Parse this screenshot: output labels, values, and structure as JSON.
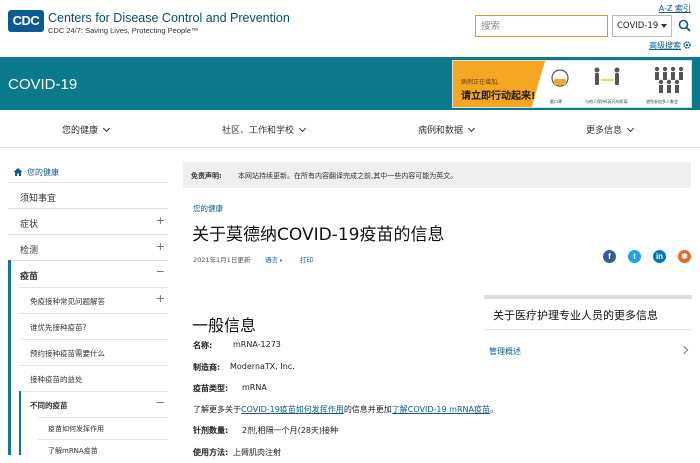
{
  "header": {
    "logo_text": "CDC",
    "org_name": "Centers for Disease Control and Prevention",
    "tagline": "CDC 24/7: Saving Lives, Protecting People™",
    "az_index": "A-Z 索引",
    "search_placeholder": "搜索",
    "search_scope": "COVID-19",
    "advanced_search": "高级搜索"
  },
  "banner": {
    "title": "COVID-19",
    "ad_small_text": "病例正在增加,",
    "ad_headline": "请立即行动起来!",
    "ad_captions": [
      "戴口罩",
      "与他人保持6英尺的距离",
      "避免参加多人聚会"
    ]
  },
  "nav": {
    "items": [
      {
        "label": "您的健康"
      },
      {
        "label": "社区、工作和学校"
      },
      {
        "label": "病例和数据"
      },
      {
        "label": "更多信息"
      }
    ]
  },
  "sidebar": {
    "home": "您的健康",
    "items": [
      {
        "label": "须知事宜"
      },
      {
        "label": "症状"
      },
      {
        "label": "检测"
      },
      {
        "label": "疫苗"
      }
    ],
    "vaccine_sub": [
      {
        "label": "免疫接种常见问题解答"
      },
      {
        "label": "谁优先接种疫苗?"
      },
      {
        "label": "预约接种疫苗需要什么"
      },
      {
        "label": "接种疫苗的益处"
      },
      {
        "label": "不同的疫苗"
      }
    ],
    "different_vaccines_sub": [
      {
        "label": "疫苗如何发挥作用"
      },
      {
        "label": "了解mRNA疫苗"
      }
    ]
  },
  "content": {
    "disclaimer_label": "免责声明:",
    "disclaimer_text": "本网站持续更新。在所有内容翻译完成之前,其中一些内容可能为英文。",
    "breadcrumb": "您的健康",
    "title": "关于莫德纳COVID-19疫苗的信息",
    "date": "2021年1月1日更新",
    "language": "语言",
    "print": "打印",
    "section_title": "一般信息",
    "name_label": "名称:",
    "name_value": "mRNA-1273",
    "maker_label": "制造商:",
    "maker_value": "ModernaTX, Inc.",
    "type_label": "疫苗类型:",
    "type_value": "mRNA",
    "learn_prefix": "了解更多关于",
    "learn_link1": "COVID-19疫苗如何发挥作用",
    "learn_mid": "的信息并更加",
    "learn_link2": "了解COVID-19 mRNA疫苗",
    "learn_suffix": "。",
    "dose_label": "针剂数量:",
    "dose_value": "2剂,相隔一个月(28天)接种",
    "usage_label": "使用方法:",
    "usage_value": "上臂肌肉注射"
  },
  "side_box": {
    "title": "关于医疗护理专业人员的更多信息",
    "link": "管理概述"
  },
  "colors": {
    "teal": "#0a7a8c",
    "link": "#0b5a91",
    "accent_orange": "#f5a623",
    "facebook": "#3b5998",
    "twitter": "#1da1f2",
    "linkedin": "#0077b5",
    "syndicate": "#e8692c"
  }
}
